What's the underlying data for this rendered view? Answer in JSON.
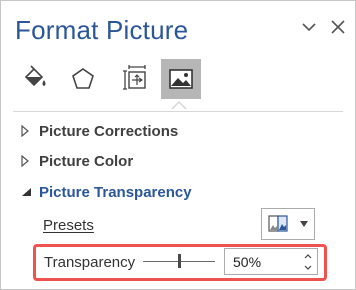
{
  "pane": {
    "title": "Format Picture",
    "options_icon": "chevron-down-icon",
    "close_icon": "close-icon"
  },
  "tabs": [
    {
      "name": "Fill & Line",
      "icon": "paint-bucket-icon",
      "active": false
    },
    {
      "name": "Effects",
      "icon": "pentagon-icon",
      "active": false
    },
    {
      "name": "Size & Properties",
      "icon": "size-properties-icon",
      "active": false
    },
    {
      "name": "Picture",
      "icon": "picture-icon",
      "active": true
    }
  ],
  "sections": [
    {
      "label": "Picture Corrections",
      "expanded": false
    },
    {
      "label": "Picture Color",
      "expanded": false
    },
    {
      "label": "Picture Transparency",
      "expanded": true
    }
  ],
  "transparency": {
    "presets_label": "Presets",
    "transparency_label": "Transparency",
    "value": "50%",
    "slider_level": 0.5
  },
  "colors": {
    "accent": "#2B579A",
    "highlight": "#EF5350",
    "active_tab": "#B6B6B6"
  }
}
